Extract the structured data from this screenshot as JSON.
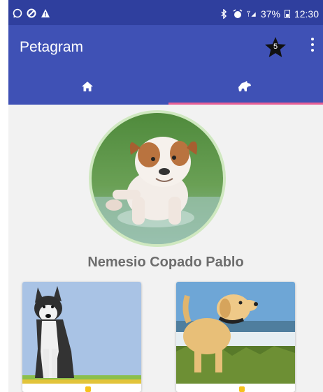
{
  "status_bar": {
    "left_icons": [
      "whatsapp-icon",
      "block-icon",
      "warning-icon"
    ],
    "right_icons": [
      "bluetooth-icon",
      "alarm-icon",
      "signal-icon",
      "battery-icon"
    ],
    "battery_text": "37%",
    "time": "12:30"
  },
  "app_bar": {
    "title": "Petagram",
    "rating_count": "5",
    "rating_icon": "star-icon",
    "menu_icon": "overflow-menu-icon"
  },
  "tabs": [
    {
      "icon": "home-icon",
      "selected": false
    },
    {
      "icon": "dog-icon",
      "selected": true
    }
  ],
  "colors": {
    "primary": "#3f51b5",
    "primary_dark": "#2f3f9e",
    "indicator": "#e85f96",
    "name_text": "#6d6d6d"
  },
  "profile": {
    "name": "Nemesio Copado Pablo",
    "image": "bulldog-puppy"
  },
  "gallery": [
    {
      "image": "husky"
    },
    {
      "image": "golden-retriever-puppy"
    }
  ]
}
